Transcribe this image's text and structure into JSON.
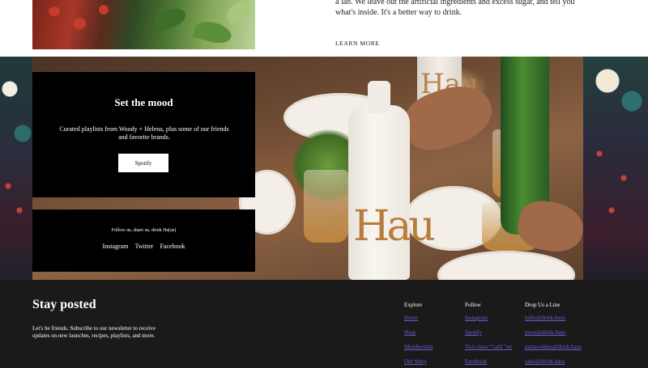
{
  "intro": {
    "body_text": "a lab. We leave out the artificial ingredients and excess sugar, and tell you what's inside. It's a better way to drink.",
    "learn_more": "LEARN MORE"
  },
  "hero": {
    "bottle_logo": "Hau",
    "mood_card": {
      "title": "Set the mood",
      "description": "Curated playlists from Woody + Helena, plus some of our friends and favorite brands.",
      "button": "Spotify"
    },
    "follow_card": {
      "label": "Follow us, share us, drink Ha(us)",
      "links": [
        "Instagram",
        "Twitter",
        "Facebook"
      ]
    }
  },
  "footer": {
    "newsletter": {
      "title": "Stay posted",
      "description": "Let's be friends. Subscribe to our newsletter to receive updates on new launches, recipes, playlists, and more."
    },
    "columns": [
      {
        "heading": "Explore",
        "links": [
          "Home",
          "Shop",
          "Membership",
          "Our Story"
        ]
      },
      {
        "heading": "Follow",
        "links": [
          "Instagram",
          "Spotify",
          "Twit class=\"sahl \"ter",
          "Facebook"
        ]
      },
      {
        "heading": "Drop Us a Line",
        "links": [
          "hello@drink.haus",
          "press@drink.haus",
          "partnerships@drink.haus",
          "sales@drink.haus"
        ]
      }
    ],
    "link_color": "#6f5bd2",
    "background": "#1b1a1a"
  }
}
